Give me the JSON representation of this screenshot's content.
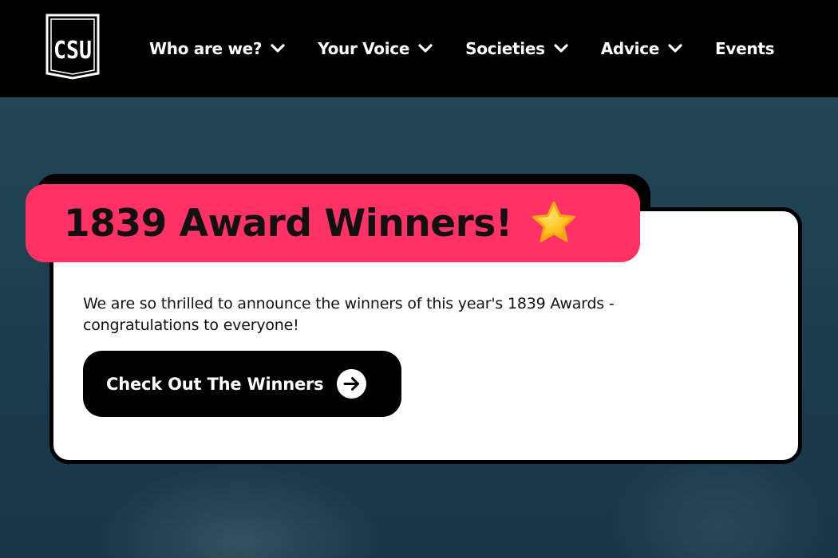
{
  "logo": {
    "text": "CSU",
    "icon": "csu-shield-logo"
  },
  "nav": [
    {
      "label": "Who are we?",
      "dropdown": true
    },
    {
      "label": "Your Voice",
      "dropdown": true
    },
    {
      "label": "Societies",
      "dropdown": true
    },
    {
      "label": "Advice",
      "dropdown": true
    },
    {
      "label": "Events",
      "dropdown": false
    }
  ],
  "announcement": {
    "title": "1839 Award Winners!",
    "title_icon": "star-emoji",
    "body": "We are so thrilled to announce the winners of this year's 1839 Awards - congratulations to everyone!",
    "button_label": "Check Out The Winners",
    "button_icon": "arrow-right-circle-icon"
  },
  "colors": {
    "header_bg": "#000000",
    "accent_pink": "#ff3165",
    "card_bg": "#ffffff",
    "button_bg": "#000000",
    "hero_bg": "#1f4253"
  }
}
